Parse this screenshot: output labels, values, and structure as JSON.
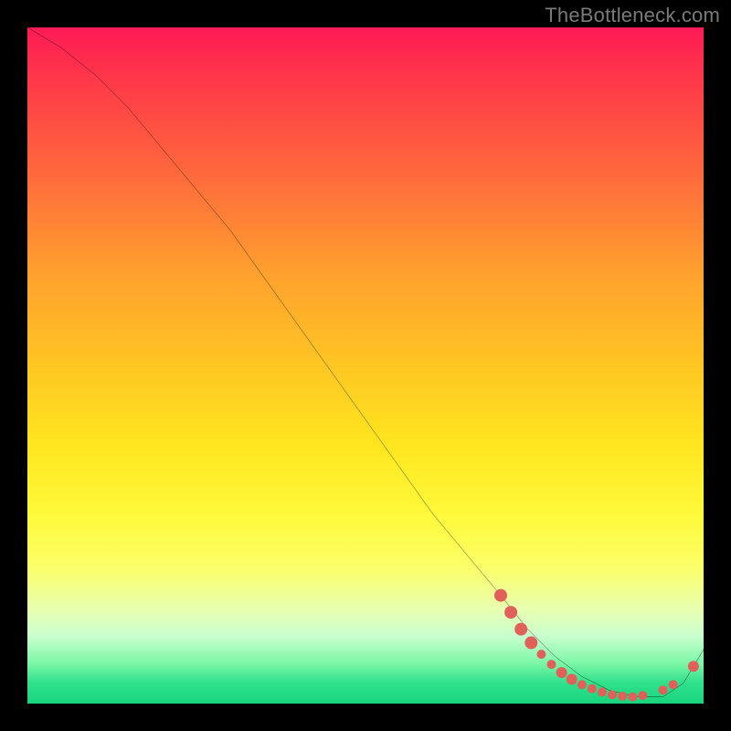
{
  "watermark": "TheBottleneck.com",
  "chart_data": {
    "type": "line",
    "title": "",
    "xlabel": "",
    "ylabel": "",
    "xlim": [
      0,
      100
    ],
    "ylim": [
      0,
      100
    ],
    "grid": false,
    "legend": false,
    "background_gradient": {
      "top_color": "#ff1a55",
      "mid_color": "#ffe61f",
      "bottom_color": "#17d57d"
    },
    "series": [
      {
        "name": "bottleneck-curve",
        "color": "#000000",
        "x": [
          0,
          5,
          10,
          15,
          20,
          25,
          30,
          35,
          40,
          45,
          50,
          55,
          60,
          65,
          70,
          74,
          78,
          82,
          86,
          90,
          94,
          97,
          100
        ],
        "y": [
          100,
          97,
          93,
          88,
          82,
          76,
          70,
          63,
          56,
          49,
          42,
          35,
          28,
          22,
          16,
          11,
          7,
          4,
          2,
          1,
          1,
          3,
          8
        ]
      }
    ],
    "markers": {
      "name": "highlight-points",
      "color": "#e2605a",
      "radius_major": 7,
      "radius_minor": 5,
      "points": [
        {
          "x": 70.0,
          "y": 16.0,
          "r": 7
        },
        {
          "x": 71.5,
          "y": 13.5,
          "r": 7
        },
        {
          "x": 73.0,
          "y": 11.0,
          "r": 7
        },
        {
          "x": 74.5,
          "y": 9.0,
          "r": 7
        },
        {
          "x": 76.0,
          "y": 7.3,
          "r": 5
        },
        {
          "x": 77.5,
          "y": 5.8,
          "r": 5
        },
        {
          "x": 79.0,
          "y": 4.6,
          "r": 6
        },
        {
          "x": 80.5,
          "y": 3.6,
          "r": 6
        },
        {
          "x": 82.0,
          "y": 2.8,
          "r": 5
        },
        {
          "x": 83.5,
          "y": 2.2,
          "r": 5
        },
        {
          "x": 85.0,
          "y": 1.7,
          "r": 5
        },
        {
          "x": 86.5,
          "y": 1.3,
          "r": 5
        },
        {
          "x": 88.0,
          "y": 1.1,
          "r": 5
        },
        {
          "x": 89.5,
          "y": 1.0,
          "r": 5
        },
        {
          "x": 91.0,
          "y": 1.2,
          "r": 5
        },
        {
          "x": 94.0,
          "y": 2.0,
          "r": 5
        },
        {
          "x": 95.5,
          "y": 2.8,
          "r": 5
        },
        {
          "x": 98.5,
          "y": 5.5,
          "r": 6
        }
      ]
    }
  }
}
